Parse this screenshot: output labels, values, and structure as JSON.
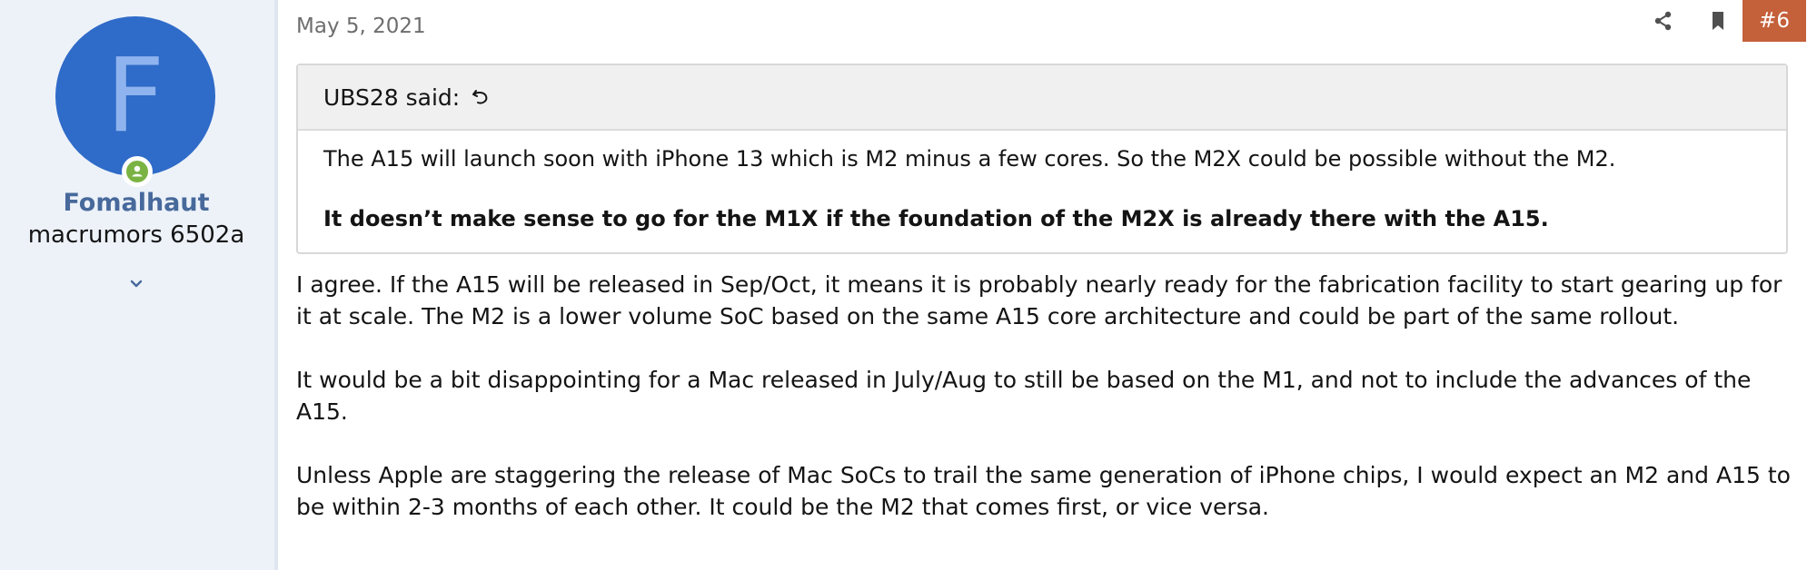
{
  "user": {
    "avatar_letter": "F",
    "name": "Fomalhaut",
    "title": "macrumors 6502a",
    "online": true
  },
  "post": {
    "date": "May 5, 2021",
    "number": "#6",
    "quote": {
      "author_label": "UBS28 said:",
      "line1": "The A15 will launch soon with iPhone 13 which is M2 minus a few cores. So the M2X could be possible without the M2.",
      "line2": "It doesn’t make sense to go for the M1X if the foundation of the M2X is already there with the A15."
    },
    "paragraphs": [
      "I agree. If the A15 will be released in Sep/Oct, it means it is probably nearly ready for the fabrication facility to start gearing up for it at scale. The M2 is a lower volume SoC based on the same A15 core architecture and could be part of the same rollout.",
      "It would be a bit disappointing for a Mac released in July/Aug to still be based on the M1, and not to include the advances of the A15.",
      "Unless Apple are staggering the release of Mac SoCs to trail the same generation of iPhone chips, I would expect an M2 and A15 to be within 2-3 months of each other. It could be the M2 that comes first, or vice versa."
    ]
  },
  "colors": {
    "avatar_bg": "#2f6bc8",
    "username": "#47699b",
    "post_number_bg": "#c4603a",
    "online": "#7ab343",
    "panel_bg": "#edf2f9"
  },
  "icons": {
    "share": "share-icon",
    "bookmark": "bookmark-icon",
    "jump": "jump-to-quote-icon",
    "expand": "chevron-down-icon",
    "online": "online-status-icon"
  }
}
